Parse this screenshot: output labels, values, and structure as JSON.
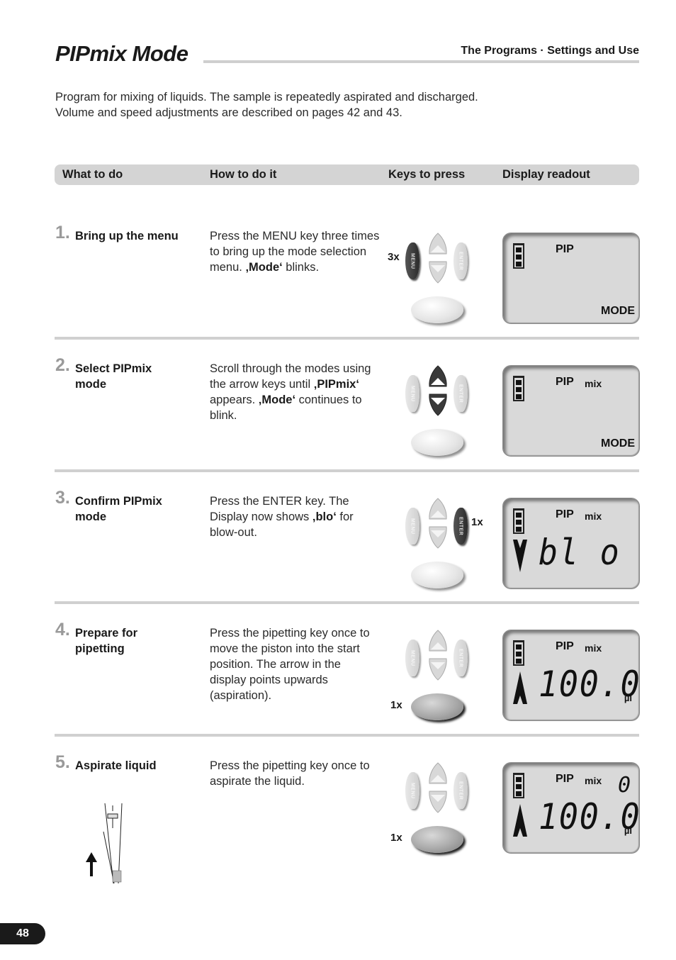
{
  "header": {
    "title": "PIPmix Mode",
    "section": "The Programs · Settings and Use"
  },
  "intro": {
    "line1": "Program for mixing of liquids. The sample is repeatedly aspirated and discharged.",
    "line2": "Volume and speed adjustments are described on pages 42 and 43."
  },
  "table": {
    "columns": [
      "What to do",
      "How to do it",
      "Keys to press",
      "Display readout"
    ]
  },
  "keys": {
    "menu": "MENU",
    "enter": "ENTER"
  },
  "steps": [
    {
      "number": "1.",
      "title": "Bring up the menu",
      "desc": [
        {
          "t": "Press the MENU key three times to bring up the mode selection menu. ",
          "b": false
        },
        {
          "t": "‚Mode‘",
          "b": true
        },
        {
          "t": " blinks.",
          "b": false
        }
      ],
      "active_keys": [
        "menu"
      ],
      "press_count": "3x",
      "display": {
        "line1": "PIP",
        "line1_sub": "",
        "main": "",
        "unit": "",
        "mode": "MODE",
        "counter": "",
        "arrow": "none"
      }
    },
    {
      "number": "2.",
      "title": "Select PIPmix mode",
      "desc": [
        {
          "t": "Scroll through the modes using the arrow keys until ",
          "b": false
        },
        {
          "t": "‚PIPmix‘",
          "b": true
        },
        {
          "t": " appears. ",
          "b": false
        },
        {
          "t": "‚Mode‘",
          "b": true
        },
        {
          "t": " continues to blink.",
          "b": false
        }
      ],
      "active_keys": [
        "up",
        "down"
      ],
      "press_count": "",
      "display": {
        "line1": "PIP",
        "line1_sub": "mix",
        "main": "",
        "unit": "",
        "mode": "MODE",
        "counter": "",
        "arrow": "none"
      }
    },
    {
      "number": "3.",
      "title": "Confirm PIPmix mode",
      "desc": [
        {
          "t": "Press the ENTER key. The Display now shows ",
          "b": false
        },
        {
          "t": "‚blo‘",
          "b": true
        },
        {
          "t": " for blow-out.",
          "b": false
        }
      ],
      "active_keys": [
        "enter"
      ],
      "press_count": "1x",
      "display": {
        "line1": "PIP",
        "line1_sub": "mix",
        "main": "bl o",
        "unit": "",
        "mode": "",
        "counter": "",
        "arrow": "down"
      }
    },
    {
      "number": "4.",
      "title": "Prepare for pipetting",
      "desc": [
        {
          "t": "Press the pipetting key once to move the piston into the start position. The arrow in the display points upwards (aspiration).",
          "b": false
        }
      ],
      "active_keys": [
        "pip"
      ],
      "press_count": "1x",
      "display": {
        "line1": "PIP",
        "line1_sub": "mix",
        "main": "100.0",
        "unit": "µl",
        "mode": "",
        "counter": "",
        "arrow": "up"
      }
    },
    {
      "number": "5.",
      "title": "Aspirate liquid",
      "desc": [
        {
          "t": "Press the pipetting key once to aspirate the liquid.",
          "b": false
        }
      ],
      "active_keys": [
        "pip"
      ],
      "press_count": "1x",
      "display": {
        "line1": "PIP",
        "line1_sub": "mix",
        "main": "100.0",
        "unit": "µl",
        "mode": "",
        "counter": "0",
        "arrow": "up"
      }
    }
  ],
  "footer": {
    "page_number": "48"
  }
}
